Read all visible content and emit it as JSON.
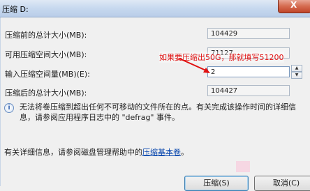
{
  "window": {
    "title": "压缩 D:",
    "close_label": "X"
  },
  "rows": {
    "total_before_label": "压缩前的总计大小(MB):",
    "total_before_value": "104429",
    "available_label": "可用压缩空间大小(MB):",
    "available_value": "71127",
    "amount_label": "输入压缩空间量(MB)(E):",
    "amount_value": "2",
    "total_after_label": "压缩后的总计大小(MB):",
    "total_after_value": "104427"
  },
  "spinner": {
    "up": "▲",
    "down": "▼"
  },
  "annotation": "如果要压缩出50G，那就填写51200",
  "info": {
    "icon_glyph": "i",
    "text": "无法将卷压缩到超出任何不可移动的文件所在的点。有关完成该操作时间的详细信息，请参阅应用程序日志中的 \"defrag\" 事件。"
  },
  "help": {
    "prefix": "有关详细信息，请参阅磁盘管理帮助中的",
    "link": "压缩基本卷",
    "suffix": "。"
  },
  "buttons": {
    "shrink": "压缩(S)",
    "cancel": "取消(C)"
  },
  "colors": {
    "annotation": "#e01010",
    "link": "#0645ad",
    "close": "#d56b4f"
  }
}
